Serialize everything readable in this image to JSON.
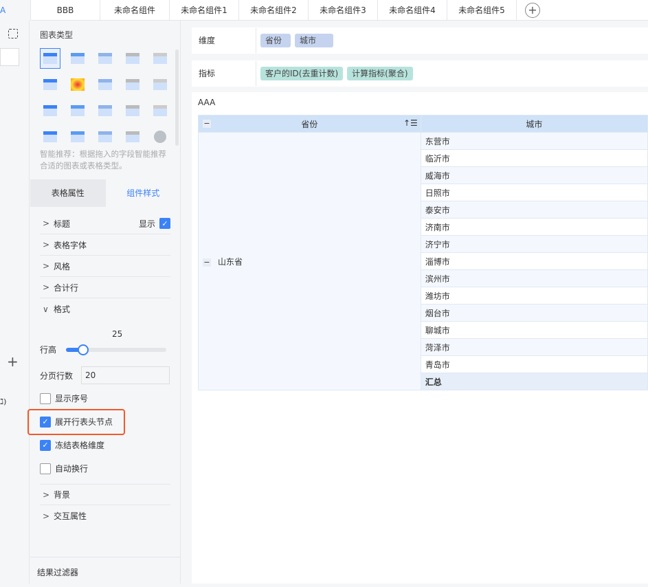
{
  "tabs": {
    "first": "A",
    "items": [
      "BBB",
      "未命名组件",
      "未命名组件1",
      "未命名组件2",
      "未命名组件3",
      "未命名组件4",
      "未命名组件5"
    ],
    "add": "+"
  },
  "leftstrip": {
    "add": "+",
    "cut_text": "ℷ)"
  },
  "panel": {
    "chart_type_title": "图表类型",
    "hint": "智能推荐：根据拖入的字段智能推荐合适的图表或表格类型。",
    "chart_types": [
      "cross-table-icon",
      "group-table-icon",
      "detail-table-icon",
      "kpi-number-icon",
      "kpi-list-icon",
      "dot-table-icon",
      "heatmap-icon",
      "multi-bar-icon",
      "stacked-bar-icon",
      "grouped-bar-icon",
      "funnel-icon",
      "waterfall-icon",
      "multi-line-icon",
      "line-icon",
      "radar-icon",
      "area-icon",
      "combo-icon",
      "scatter-icon",
      "bubble-icon",
      "pie-icon"
    ],
    "tab_props": "表格属性",
    "tab_style": "组件样式",
    "sections": {
      "title": "标题",
      "show": "显示",
      "font": "表格字体",
      "style": "风格",
      "total": "合计行",
      "format": "格式",
      "background": "背景",
      "interaction": "交互属性"
    },
    "row_height_label": "行高",
    "row_height_value": "25",
    "row_height_fill_pct": 17,
    "page_rows_label": "分页行数",
    "page_rows_value": "20",
    "checks": [
      {
        "label": "显示序号",
        "checked": false
      },
      {
        "label": "展开行表头节点",
        "checked": true
      },
      {
        "label": "冻结表格维度",
        "checked": true
      },
      {
        "label": "自动换行",
        "checked": false
      }
    ],
    "footer": "结果过滤器"
  },
  "fields": {
    "dim_label": "维度",
    "dims": [
      "省份",
      "城市"
    ],
    "meas_label": "指标",
    "measures": [
      "客户的ID(去重计数)",
      "计算指标(聚合)"
    ]
  },
  "table": {
    "title": "AAA",
    "headers": [
      "省份",
      "城市"
    ],
    "minus": "−",
    "province": "山东省",
    "cities": [
      "东营市",
      "临沂市",
      "威海市",
      "日照市",
      "泰安市",
      "济南市",
      "济宁市",
      "淄博市",
      "滨州市",
      "潍坊市",
      "烟台市",
      "聊城市",
      "菏泽市",
      "青岛市"
    ],
    "total": "汇总"
  },
  "colors": {
    "accent": "#3b82f6",
    "dim_pill": "#c5d3ef",
    "measure_pill": "#b7e3dd",
    "highlight": "#f05a2a"
  }
}
